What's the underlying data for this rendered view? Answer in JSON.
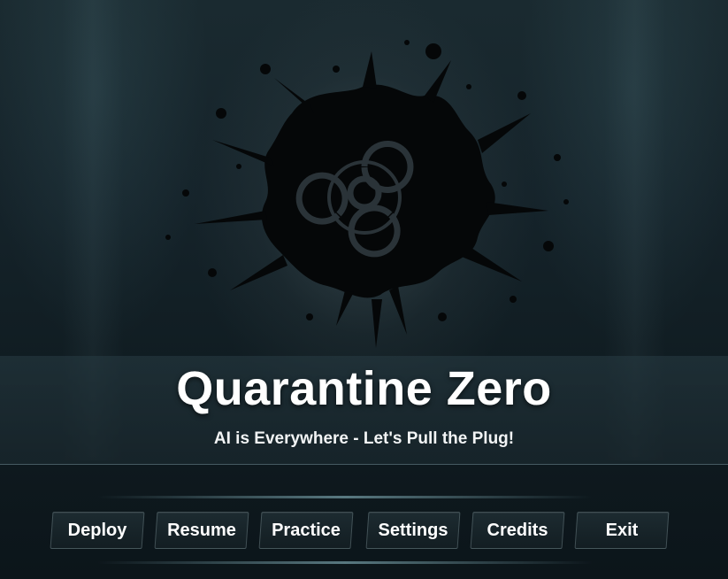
{
  "game": {
    "title": "Quarantine Zero",
    "tagline": "AI is Everywhere - Let's Pull the Plug!"
  },
  "emblem": {
    "icon": "biohazard-icon",
    "splat_color": "#050708"
  },
  "menu": {
    "items": [
      {
        "label": "Deploy"
      },
      {
        "label": "Resume"
      },
      {
        "label": "Practice"
      },
      {
        "label": "Settings"
      },
      {
        "label": "Credits"
      },
      {
        "label": "Exit"
      }
    ]
  },
  "colors": {
    "background": "#15232a",
    "text": "#ffffff",
    "accent_glow": "#96c8d2"
  }
}
